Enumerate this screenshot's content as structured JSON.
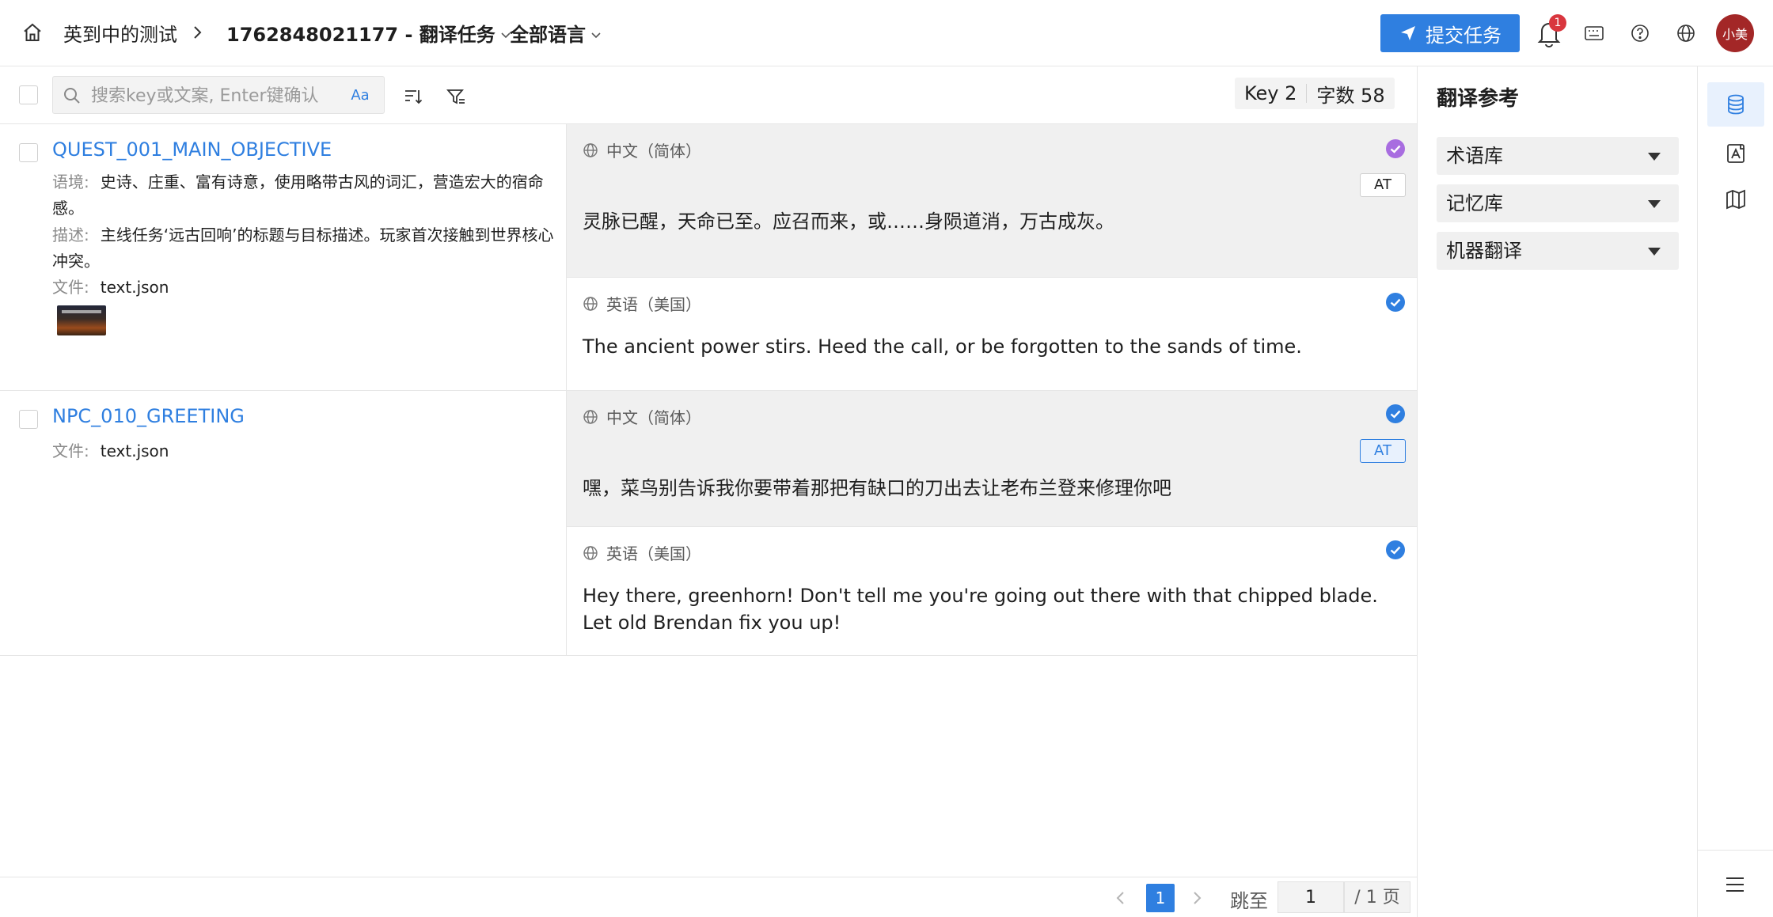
{
  "header": {
    "project_name": "英到中的测试",
    "task_name": "1762848021177 - 翻译任务",
    "language_filter": "全部语言",
    "submit_label": "提交任务",
    "notification_count": "1",
    "user_name": "小美",
    "colors": {
      "primary": "#2f7fe0",
      "badge": "#d9363e",
      "avatar": "#a32727"
    }
  },
  "toolbar": {
    "search_placeholder": "搜索key或文案, Enter键确认",
    "case_toggle": "Aa",
    "key_count": "Key 2",
    "word_count": "字数 58"
  },
  "rows": [
    {
      "key": "QUEST_001_MAIN_OBJECTIVE",
      "context_label": "语境:",
      "context": "史诗、庄重、富有诗意，使用略带古风的词汇，营造宏大的宿命感。",
      "description_label": "描述:",
      "description": "主线任务‘远古回响’的标题与目标描述。玩家首次接触到世界核心冲突。",
      "file_label": "文件:",
      "file": "text.json",
      "source": {
        "language": "中文（简体）",
        "text": "灵脉已醒，天命已至。应召而来，或……身陨道消，万古成灰。",
        "status_color": "#a86de0",
        "badge": "AT"
      },
      "target": {
        "language": "英语（美国）",
        "text": "The ancient power stirs. Heed the call, or be forgotten to the sands of time.",
        "status_color": "#2f7fe0"
      }
    },
    {
      "key": "NPC_010_GREETING",
      "file_label": "文件:",
      "file": "text.json",
      "source": {
        "language": "中文（简体）",
        "text": "嘿，菜鸟别告诉我你要带着那把有缺口的刀出去让老布兰登来修理你吧",
        "status_color": "#2f7fe0",
        "badge": "AT"
      },
      "target": {
        "language": "英语（美国）",
        "text": "Hey there, greenhorn! Don't tell me you're going out there with that chipped blade. Let old Brendan fix you up!",
        "status_color": "#2f7fe0"
      }
    }
  ],
  "pagination": {
    "current": "1",
    "jump_label": "跳至",
    "jump_value": "1",
    "total": "/ 1 页"
  },
  "reference_panel": {
    "title": "翻译参考",
    "items": [
      "术语库",
      "记忆库",
      "机器翻译"
    ]
  },
  "rail": {
    "icons": [
      "database-icon",
      "ai-document-icon",
      "map-icon",
      "menu-icon"
    ]
  }
}
